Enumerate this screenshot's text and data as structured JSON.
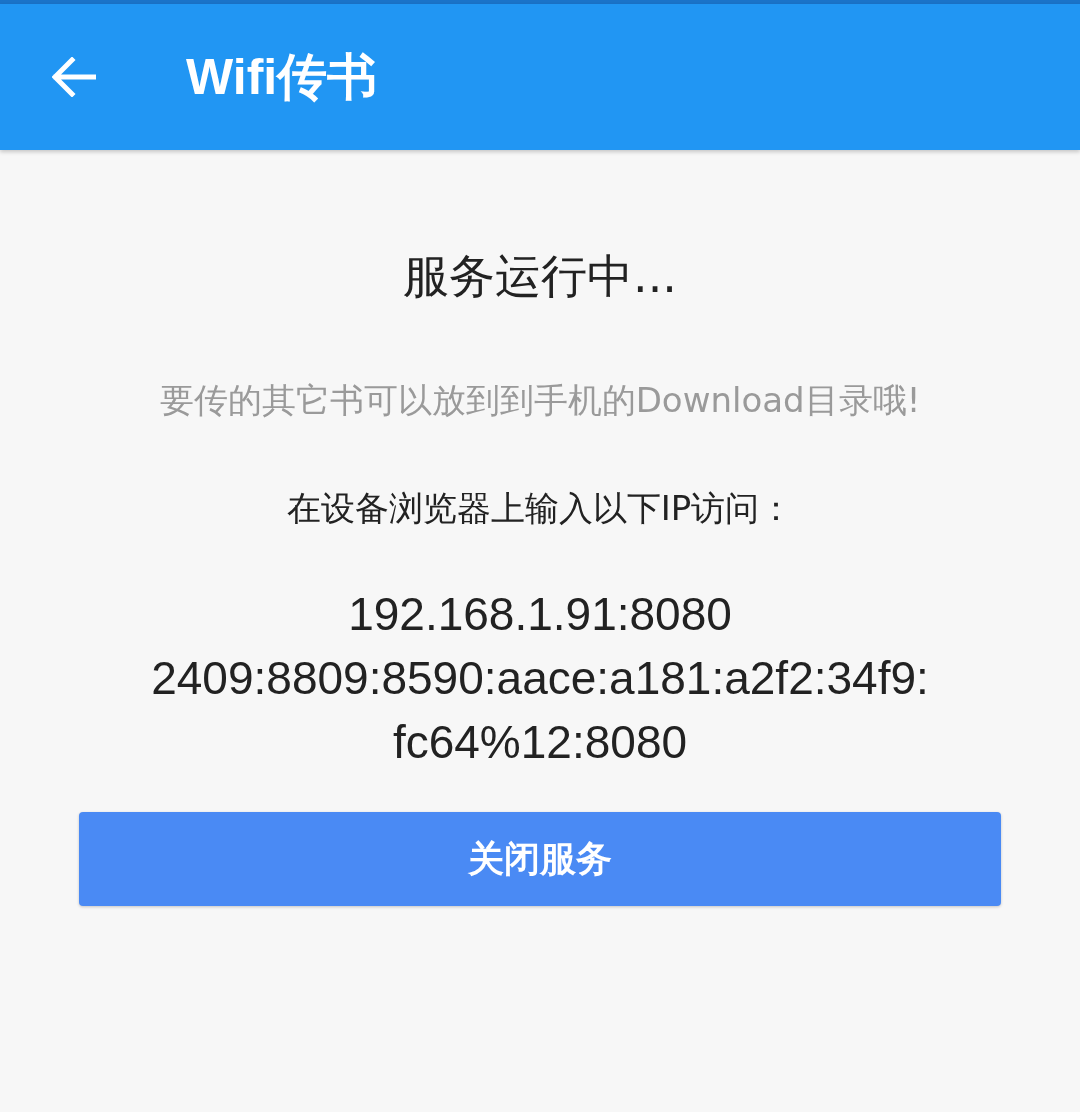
{
  "app_bar": {
    "title": "Wifi传书"
  },
  "status": "服务运行中...",
  "hint": "要传的其它书可以放到到手机的Download目录哦!",
  "instruction": "在设备浏览器上输入以下IP访问：",
  "addresses": [
    "192.168.1.91:8080",
    "2409:8809:8590:aace:a181:a2f2:34f9:fc64%12:8080"
  ],
  "button": {
    "label": "关闭服务"
  }
}
